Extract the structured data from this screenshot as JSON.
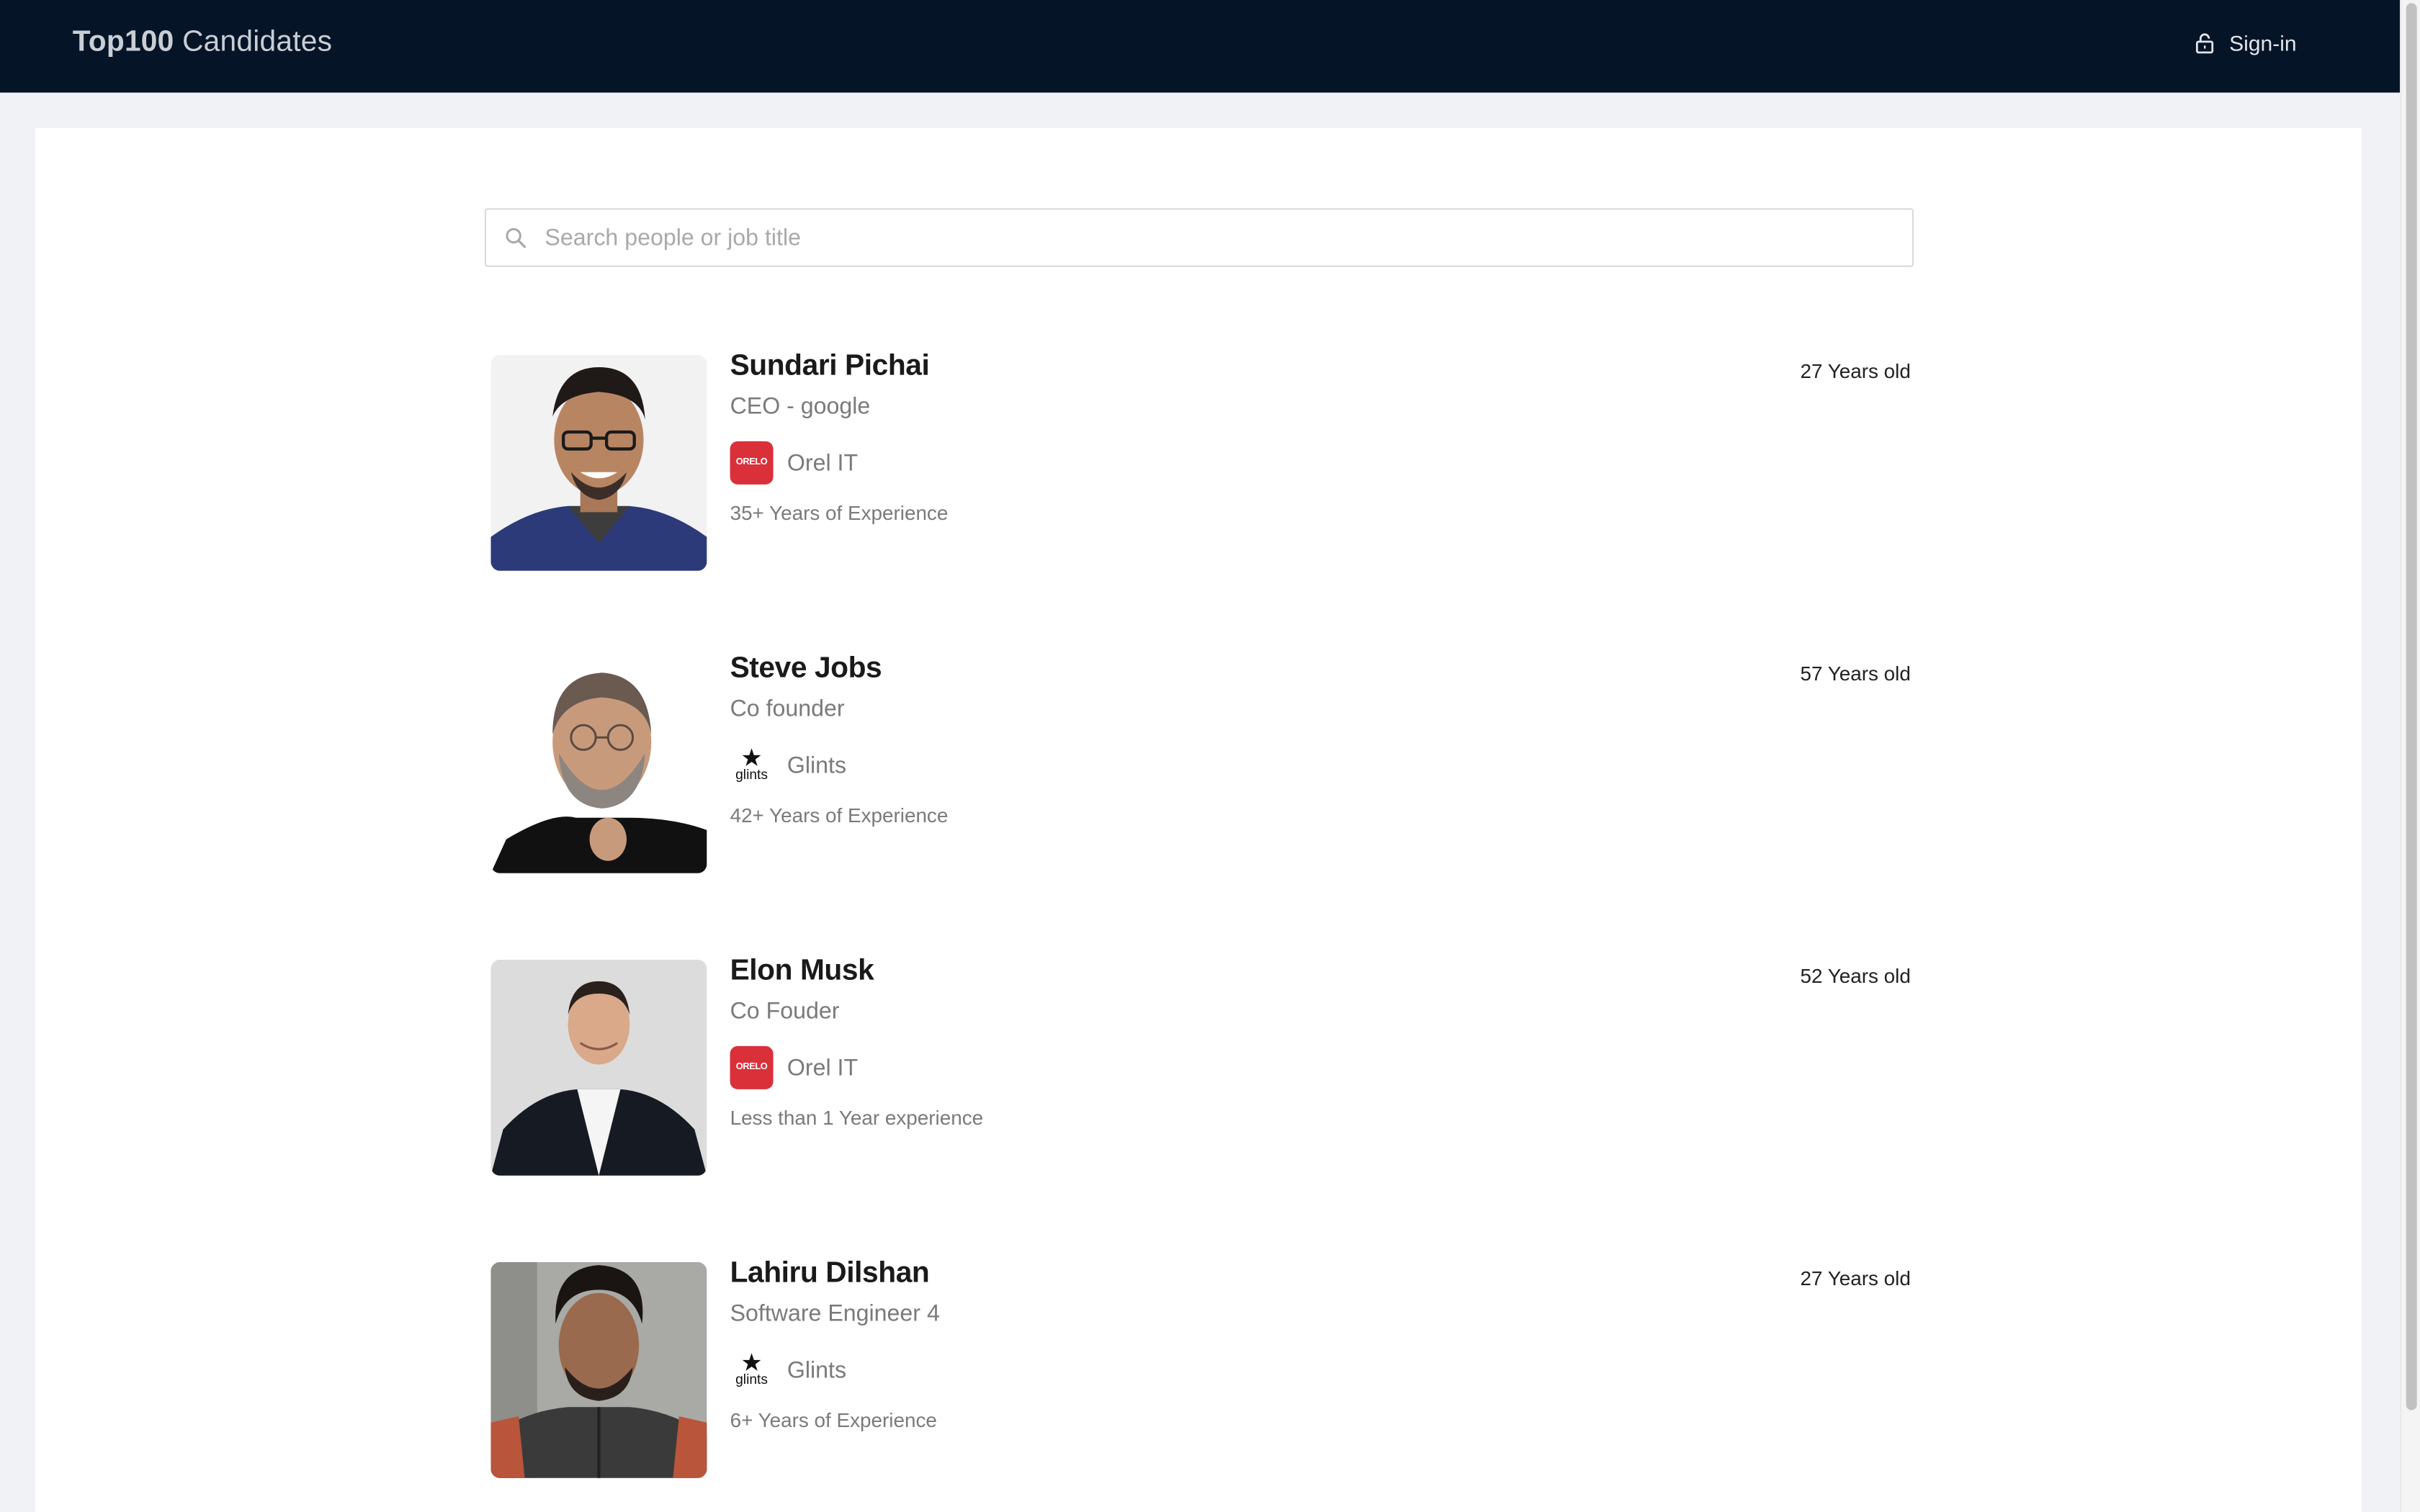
{
  "header": {
    "brand_bold": "Top100",
    "brand_rest": " Candidates",
    "signin_label": "Sign-in"
  },
  "search": {
    "placeholder": "Search people or job title",
    "value": ""
  },
  "candidates": [
    {
      "name": "Sundari Pichai",
      "title": "CEO - google",
      "company": "Orel IT",
      "company_logo": "orel-logo",
      "experience": "35+ Years of Experience",
      "age": "27 Years old"
    },
    {
      "name": "Steve Jobs",
      "title": "Co founder",
      "company": "Glints",
      "company_logo": "glints-logo",
      "experience": "42+ Years of Experience",
      "age": "57 Years old"
    },
    {
      "name": "Elon Musk",
      "title": "Co Fouder",
      "company": "Orel IT",
      "company_logo": "orel-logo",
      "experience": "Less than 1 Year experience",
      "age": "52 Years old"
    },
    {
      "name": "Lahiru Dilshan",
      "title": "Software Engineer 4",
      "company": "Glints",
      "company_logo": "glints-logo",
      "experience": "6+ Years of Experience",
      "age": "27 Years old"
    }
  ],
  "logos": {
    "orel_text": "ORELO",
    "glints_text": "glints"
  },
  "colors": {
    "header_bg": "#051426",
    "page_bg": "#f0f2f5",
    "orel_red": "#d9303a"
  }
}
